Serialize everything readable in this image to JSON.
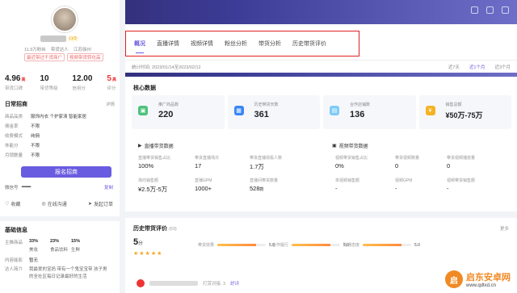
{
  "colors": {
    "accent": "#6a5ce0",
    "danger": "#e33",
    "highlight_border": "#e02020",
    "star": "#f5a623"
  },
  "profile": {
    "level": "LV3",
    "meta": [
      "11.9万粉丝",
      "带货达人",
      "江苏徐州"
    ],
    "tags": [
      "最近带过千货商广",
      "视频带货转化高"
    ],
    "stats": [
      {
        "value": "4.96",
        "suffix": "高",
        "label": "带货口碑"
      },
      {
        "value": "10",
        "suffix": "",
        "label": "带货等级"
      },
      {
        "value": "12.00",
        "suffix": "",
        "label": "信用分"
      },
      {
        "value": "5",
        "suffix": "高",
        "label": "评分"
      }
    ],
    "recruit_title": "日常招商",
    "recruit_link": "详情",
    "recruit_rows": [
      {
        "k": "商品品类",
        "v": "服饰内衣 个护家清 智能家居"
      },
      {
        "k": "佣金率",
        "v": "不限"
      },
      {
        "k": "收费模式",
        "v": "纯佣"
      },
      {
        "k": "休能分",
        "v": "不限"
      },
      {
        "k": "月销数量",
        "v": "不限"
      }
    ],
    "recruit_button": "报名招商",
    "wechat_label": "微信号",
    "wechat_value": "••••••••••••",
    "copy_label": "复制",
    "actions": [
      "收藏",
      "在线沟通",
      "发起订单"
    ]
  },
  "basic": {
    "title": "基础信息",
    "rows": [
      {
        "k": "主推商品",
        "items": [
          [
            "33%",
            "美妆"
          ],
          [
            "23%",
            "食品饮料"
          ],
          [
            "15%",
            "生鲜"
          ]
        ]
      }
    ],
    "extra": [
      {
        "k": "内容能影",
        "v": "暂无"
      },
      {
        "k": "达人简介",
        "v": "我最爱的宝妈 带有一个鬼宝宝带 孩子男的全社区每日记录最好的生活"
      }
    ]
  },
  "tabs": [
    "概况",
    "直播详情",
    "视频详情",
    "粉丝分析",
    "带货分析",
    "历史带货评价"
  ],
  "active_tab": 0,
  "date": {
    "label": "统计时间: 2023/01/14至2023/02/12",
    "ranges": [
      "近7天",
      "近1个月",
      "近3个月"
    ],
    "active_range": 1
  },
  "core": {
    "title": "核心数据",
    "cards": [
      {
        "label": "推广商品数",
        "value": "220",
        "unit": "",
        "color": "#4cc27a",
        "icon": "shopping-bag-icon"
      },
      {
        "label": "历史带货天数",
        "value": "361",
        "unit": "",
        "color": "#3a86f5",
        "icon": "calendar-icon"
      },
      {
        "label": "合作店铺数",
        "value": "136",
        "unit": "",
        "color": "#7ecbf7",
        "icon": "store-icon"
      },
      {
        "label": "销售总额",
        "value": "¥50万-75万",
        "unit": "",
        "color": "#f5b323",
        "icon": "money-bag-icon"
      }
    ],
    "live": {
      "title": "直播带货数据",
      "cells": [
        {
          "k": "直播带货销售占比",
          "v": "100%",
          "unit": ""
        },
        {
          "k": "带货直播场次",
          "v": "17",
          "unit": ""
        },
        {
          "k": "带货直播观看人数",
          "v": "1.7万",
          "unit": ""
        },
        {
          "k": "场均销售额",
          "v": "¥2.5万-5万",
          "unit": ""
        },
        {
          "k": "直播GPM",
          "v": "1000+",
          "unit": ""
        },
        {
          "k": "直播间带货数量",
          "v": "528",
          "unit": "款"
        }
      ]
    },
    "video": {
      "title": "视频带货数据",
      "cells": [
        {
          "k": "视频带货销售占比",
          "v": "0%",
          "unit": ""
        },
        {
          "k": "带货视频数量",
          "v": "0",
          "unit": ""
        },
        {
          "k": "带货视频播放量",
          "v": "0",
          "unit": ""
        },
        {
          "k": "单视频销售额",
          "v": "-",
          "unit": ""
        },
        {
          "k": "视频GPM",
          "v": "-",
          "unit": ""
        },
        {
          "k": "视频带货销售额",
          "v": "-",
          "unit": ""
        }
      ]
    }
  },
  "review": {
    "title": "历史带货评价",
    "count": "(63)",
    "more": "更多",
    "score": "5",
    "score_unit": "分",
    "stars": "★★★★★",
    "bars": [
      {
        "label": "带货效果",
        "value": "5.0",
        "fill": 0.8
      },
      {
        "label": "合作履行",
        "value": "5.0",
        "fill": 0.8
      },
      {
        "label": "沟通态度",
        "value": "5.0",
        "fill": 0.8
      }
    ],
    "comment_prefix": "打赏对接, 3",
    "comment_tag": "好评"
  },
  "watermark": {
    "logo": "启",
    "title": "启东安卓网",
    "url": "www.qdtxd.cn"
  }
}
